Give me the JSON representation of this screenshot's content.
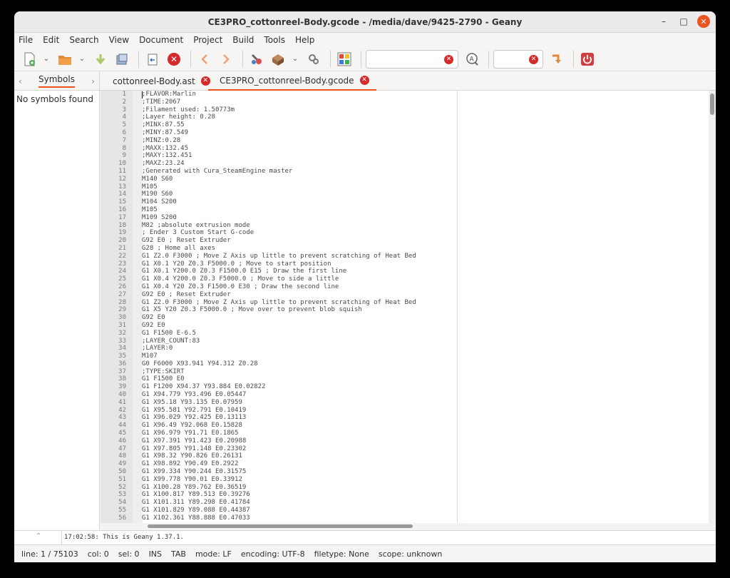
{
  "window": {
    "title": "CE3PRO_cottonreel-Body.gcode - /media/dave/9425-2790 - Geany"
  },
  "menu": [
    "File",
    "Edit",
    "Search",
    "View",
    "Document",
    "Project",
    "Build",
    "Tools",
    "Help"
  ],
  "toolbar": {
    "search_value": "",
    "goto_value": ""
  },
  "sidebar": {
    "tab_label": "Symbols",
    "empty_message": "No symbols found"
  },
  "tabs": [
    {
      "label": "cottonreel-Body.ast",
      "active": false
    },
    {
      "label": "CE3PRO_cottonreel-Body.gcode",
      "active": true
    }
  ],
  "editor": {
    "lines": [
      ";FLAVOR:Marlin",
      ";TIME:2067",
      ";Filament used: 1.50773m",
      ";Layer height: 0.28",
      ";MINX:87.55",
      ";MINY:87.549",
      ";MINZ:0.28",
      ";MAXX:132.45",
      ";MAXY:132.451",
      ";MAXZ:23.24",
      ";Generated with Cura_SteamEngine master",
      "M140 S60",
      "M105",
      "M190 S60",
      "M104 S200",
      "M105",
      "M109 S200",
      "M82 ;absolute extrusion mode",
      "; Ender 3 Custom Start G-code",
      "G92 E0 ; Reset Extruder",
      "G28 ; Home all axes",
      "G1 Z2.0 F3000 ; Move Z Axis up little to prevent scratching of Heat Bed",
      "G1 X0.1 Y20 Z0.3 F5000.0 ; Move to start position",
      "G1 X0.1 Y200.0 Z0.3 F1500.0 E15 ; Draw the first line",
      "G1 X0.4 Y200.0 Z0.3 F5000.0 ; Move to side a little",
      "G1 X0.4 Y20 Z0.3 F1500.0 E30 ; Draw the second line",
      "G92 E0 ; Reset Extruder",
      "G1 Z2.0 F3000 ; Move Z Axis up little to prevent scratching of Heat Bed",
      "G1 X5 Y20 Z0.3 F5000.0 ; Move over to prevent blob squish",
      "G92 E0",
      "G92 E0",
      "G1 F1500 E-6.5",
      ";LAYER_COUNT:83",
      ";LAYER:0",
      "M107",
      "G0 F6000 X93.941 Y94.312 Z0.28",
      ";TYPE:SKIRT",
      "G1 F1500 E0",
      "G1 F1200 X94.37 Y93.884 E0.02822",
      "G1 X94.779 Y93.496 E0.05447",
      "G1 X95.18 Y93.135 E0.07959",
      "G1 X95.581 Y92.791 E0.10419",
      "G1 X96.029 Y92.425 E0.13113",
      "G1 X96.49 Y92.068 E0.15828",
      "G1 X96.979 Y91.71 E0.1865",
      "G1 X97.391 Y91.423 E0.20988",
      "G1 X97.805 Y91.148 E0.23302",
      "G1 X98.32 Y90.826 E0.26131",
      "G1 X98.892 Y90.49 E0.2922",
      "G1 X99.334 Y90.244 E0.31575",
      "G1 X99.778 Y90.01 E0.33912",
      "G1 X100.28 Y89.762 E0.36519",
      "G1 X100.817 Y89.513 E0.39276",
      "G1 X101.311 Y89.298 E0.41784",
      "G1 X101.829 Y89.088 E0.44387",
      "G1 X102.361 Y88.888 E0.47033"
    ]
  },
  "messages": {
    "text": "17:02:58: This is Geany 1.37.1."
  },
  "status": {
    "line": "line: 1 / 75103",
    "col": "col: 0",
    "sel": "sel: 0",
    "ins": "INS",
    "tab": "TAB",
    "mode": "mode: LF",
    "encoding": "encoding: UTF-8",
    "filetype": "filetype: None",
    "scope": "scope: unknown"
  },
  "colors": {
    "accent": "#e95420",
    "close_red": "#d42a2a"
  }
}
